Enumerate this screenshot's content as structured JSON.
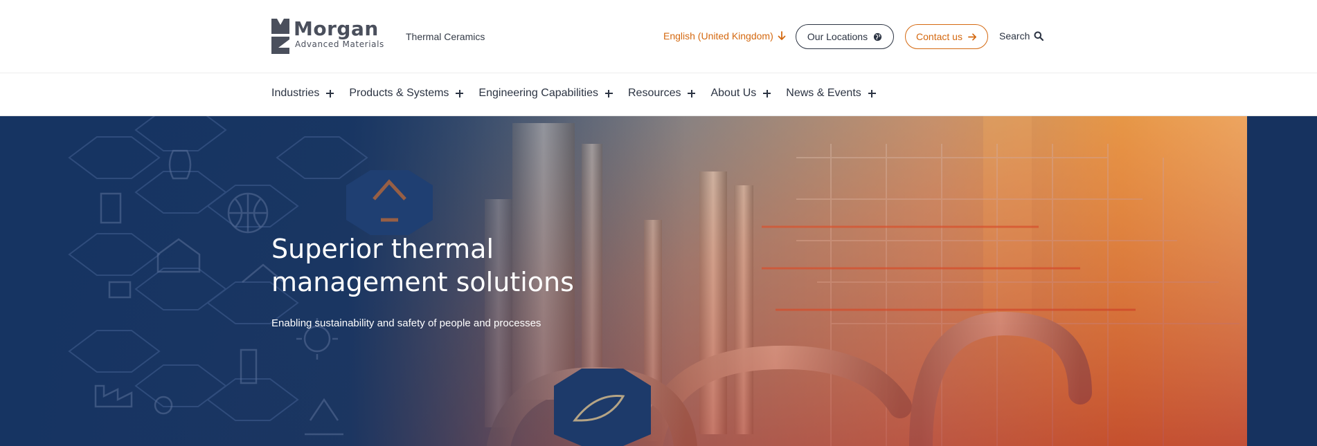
{
  "header": {
    "logo": {
      "word": "Morgan",
      "sub": "Advanced Materials"
    },
    "site_label": "Thermal Ceramics",
    "language": {
      "label": "English (United Kingdom)",
      "icon": "arrow-down-icon"
    },
    "locations_button": {
      "label": "Our Locations",
      "icon": "globe-icon"
    },
    "contact_button": {
      "label": "Contact us",
      "icon": "arrow-right-icon"
    },
    "search": {
      "label": "Search",
      "icon": "search-icon"
    }
  },
  "nav": {
    "items": [
      {
        "label": "Industries"
      },
      {
        "label": "Products & Systems"
      },
      {
        "label": "Engineering Capabilities"
      },
      {
        "label": "Resources"
      },
      {
        "label": "About Us"
      },
      {
        "label": "News & Events"
      }
    ]
  },
  "hero": {
    "title": "Superior thermal management solutions",
    "subtitle": "Enabling sustainability and safety of people and processes"
  },
  "colors": {
    "accent_orange": "#d4680f",
    "navy": "#163462",
    "text_dark": "#2b3342"
  }
}
